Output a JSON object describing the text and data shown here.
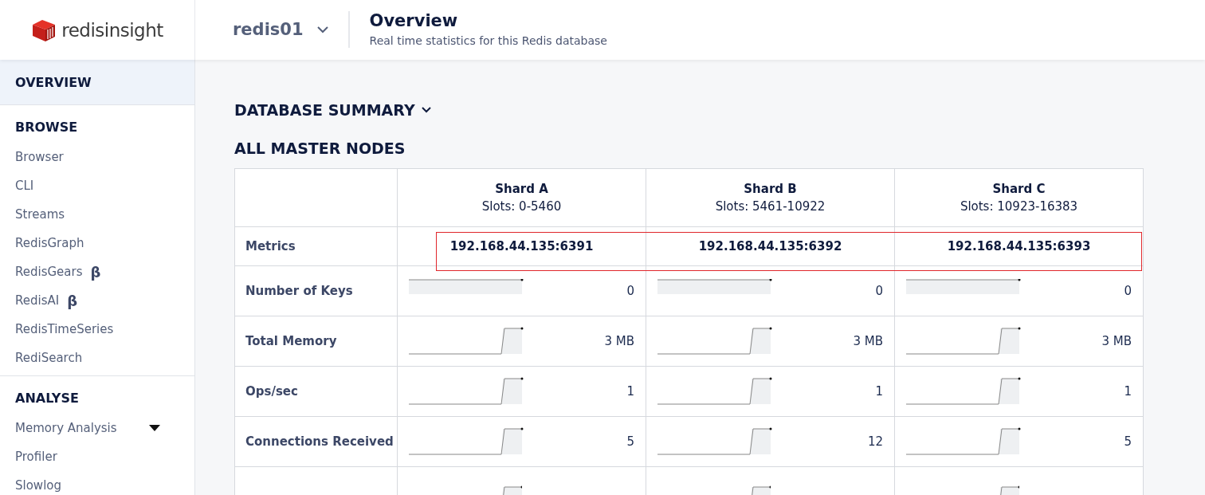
{
  "header": {
    "logo_text": "redisinsight",
    "database": "redis01",
    "title": "Overview",
    "subtitle": "Real time statistics for this Redis database"
  },
  "sidebar": {
    "overview": {
      "label": "OVERVIEW",
      "selected": true
    },
    "sections": [
      {
        "title": "BROWSE",
        "items": [
          {
            "label": "Browser",
            "kind": "link",
            "selected": false
          },
          {
            "label": "CLI",
            "kind": "link",
            "selected": false
          },
          {
            "label": "Streams",
            "kind": "link",
            "selected": false
          },
          {
            "label": "RedisGraph",
            "kind": "link",
            "selected": false
          },
          {
            "label": "RedisGears",
            "badge": "β",
            "kind": "link",
            "selected": false
          },
          {
            "label": "RedisAI",
            "badge": "β",
            "kind": "link",
            "selected": false
          },
          {
            "label": "RedisTimeSeries",
            "kind": "link",
            "selected": false
          },
          {
            "label": "RediSearch",
            "kind": "link",
            "selected": false
          }
        ]
      },
      {
        "title": "ANALYSE",
        "items": [
          {
            "label": "Memory Analysis",
            "kind": "submenu",
            "selected": false
          },
          {
            "label": "Profiler",
            "kind": "link",
            "selected": false
          },
          {
            "label": "Slowlog",
            "kind": "link",
            "selected": false
          }
        ]
      }
    ]
  },
  "summary": {
    "label": "DATABASE SUMMARY"
  },
  "nodes": {
    "title": "ALL MASTER NODES",
    "shards": [
      {
        "name": "Shard A",
        "slots": "Slots: 0-5460"
      },
      {
        "name": "Shard B",
        "slots": "Slots: 5461-10922"
      },
      {
        "name": "Shard C",
        "slots": "Slots: 10923-16383"
      }
    ],
    "metrics_row": {
      "label": "Metrics",
      "highlighted": true,
      "values": [
        "192.168.44.135:6391",
        "192.168.44.135:6392",
        "192.168.44.135:6393"
      ]
    },
    "rows": [
      {
        "label": "Number of Keys",
        "kind": "flat",
        "values": [
          "0",
          "0",
          "0"
        ]
      },
      {
        "label": "Total Memory",
        "kind": "step",
        "values": [
          "3 MB",
          "3 MB",
          "3 MB"
        ]
      },
      {
        "label": "Ops/sec",
        "kind": "step",
        "values": [
          "1",
          "1",
          "1"
        ]
      },
      {
        "label": "Connections Received",
        "kind": "step",
        "values": [
          "5",
          "12",
          "5"
        ]
      },
      {
        "kind": "clipped",
        "values": []
      }
    ]
  }
}
